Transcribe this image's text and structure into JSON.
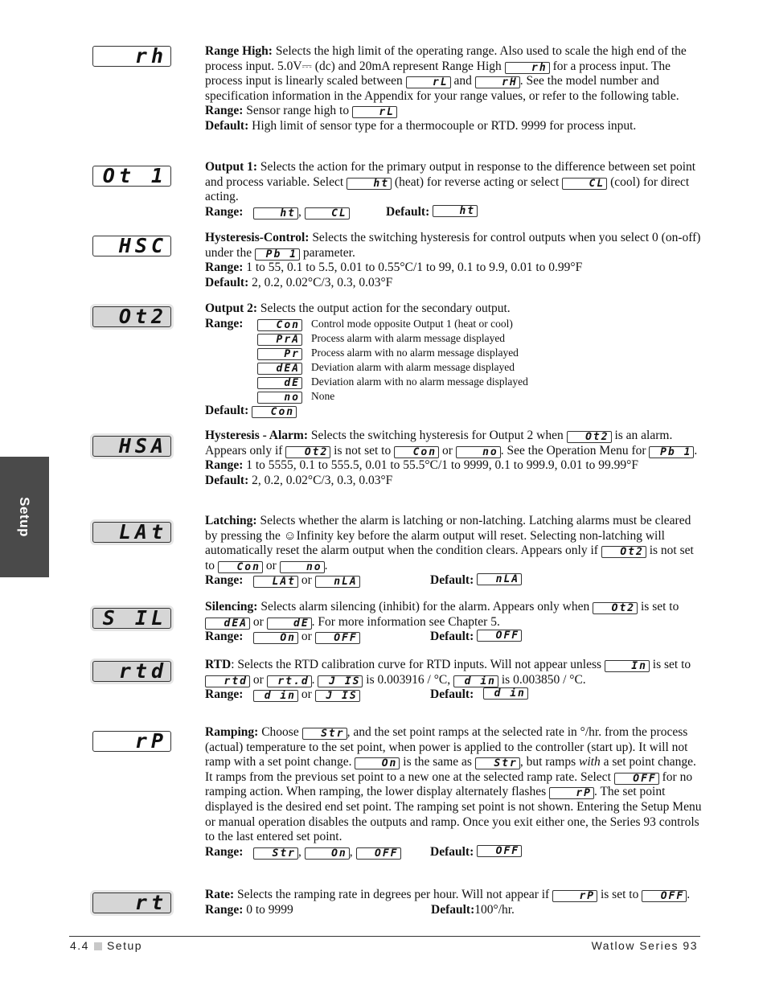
{
  "side_tab": "Setup",
  "footer": {
    "page": "4.4",
    "section": "Setup",
    "product": "Watlow Series 93"
  },
  "entries": {
    "rh": {
      "display": "rh",
      "title": "Range High:",
      "desc1": "Selects the high limit of the operating range. Also used to scale the high end of the process input. 5.0V",
      "dc_symbol": "⎓",
      "desc2": " (dc) and 20mA represent Range High ",
      "d1": "rh",
      "desc3": " for a process input. The process input is linearly scaled between ",
      "d2": "rL",
      "desc4": " and ",
      "d3": "rH",
      "desc5": ". See the model number and specification information in the Appendix for your range values, or refer to the following table.",
      "range_label": "Range:",
      "range_text": "Sensor range high to ",
      "range_d": "rL",
      "default_label": "Default:",
      "default_text": "High limit of sensor type for a thermocouple or RTD. 9999 for process input."
    },
    "ot1": {
      "display": "Ot 1",
      "title": "Output 1:",
      "desc1": "Selects the action for the primary output in response to the difference between set point and process variable. Select ",
      "d1": "ht",
      "desc2": " (heat) for reverse acting or select ",
      "d2": "CL",
      "desc3": " (cool) for direct acting.",
      "range_label": "Range:",
      "range_d1": "ht",
      "range_sep": ",",
      "range_d2": "CL",
      "default_label": "Default:",
      "default_d": "ht"
    },
    "hsc": {
      "display": "HSC",
      "title": "Hysteresis-Control:",
      "desc1": "Selects the switching hysteresis for control outputs when you select 0 (on-off) under the ",
      "d1": "Pb 1",
      "desc2": " parameter.",
      "range_label": "Range:",
      "range_text": "1 to 55, 0.1 to 5.5, 0.01 to 0.55°C/1 to 99, 0.1 to 9.9, 0.01 to 0.99°F",
      "default_label": "Default:",
      "default_text": "2, 0.2, 0.02°C/3, 0.3, 0.03°F"
    },
    "ot2": {
      "display": "Ot2",
      "title": "Output 2:",
      "desc1": "Selects the output action for the secondary output.",
      "range_label": "Range:",
      "options": [
        {
          "code": "Con",
          "text": "Control mode opposite Output 1 (heat or cool)"
        },
        {
          "code": "PrA",
          "text": "Process alarm with alarm message displayed"
        },
        {
          "code": "Pr",
          "text": "Process alarm with no alarm message displayed"
        },
        {
          "code": "dEA",
          "text": "Deviation alarm with alarm message displayed"
        },
        {
          "code": "dE",
          "text": "Deviation alarm with no alarm message displayed"
        },
        {
          "code": "no",
          "text": "None"
        }
      ],
      "default_label": "Default:",
      "default_d": "Con"
    },
    "hsa": {
      "display": "HSA",
      "title": "Hysteresis - Alarm:",
      "desc1": "Selects the switching hysteresis for Output 2 when ",
      "d1": "Ot2",
      "desc2": " is an alarm. Appears only if ",
      "d2": "Ot2",
      "desc3": " is not set to ",
      "d3": "Con",
      "desc4": " or ",
      "d4": "no",
      "desc5": ". See the Operation Menu for ",
      "d5": "Pb 1",
      "desc6": ".",
      "range_label": "Range:",
      "range_text": "1 to 5555, 0.1 to 555.5, 0.01 to 55.5°C/1 to 9999, 0.1 to 999.9, 0.01 to 99.99°F",
      "default_label": "Default:",
      "default_text": "2, 0.2, 0.02°C/3, 0.3, 0.03°F"
    },
    "lat": {
      "display": "LAt",
      "title": "Latching:",
      "desc1": "Selects whether the alarm is latching or non-latching. Latching alarms must be cleared by pressing the ",
      "key_icon": "☺",
      "desc2": "Infinity key before the alarm output will reset. Selecting non-latching will automatically reset the alarm output when the condition clears. Appears only if ",
      "d1": "Ot2",
      "desc3": " is not set to ",
      "d2": "Con",
      "desc4": " or ",
      "d3": "no",
      "desc5": ".",
      "range_label": "Range:",
      "range_d1": "LAt",
      "range_sep": " or ",
      "range_d2": "nLA",
      "default_label": "Default:",
      "default_d": "nLA"
    },
    "sil": {
      "display": "S IL",
      "title": "Silencing:",
      "desc1": "Selects alarm silencing (inhibit) for the alarm. Appears only when ",
      "d1": "Ot2",
      "desc2": " is set to ",
      "d2": "dEA",
      "desc3": " or ",
      "d3": "dE",
      "desc4": ". For more information see Chapter 5.",
      "range_label": "Range:",
      "range_d1": "On",
      "range_sep": " or ",
      "range_d2": "OFF",
      "default_label": "Default:",
      "default_d": "OFF"
    },
    "rtd": {
      "display": "rtd",
      "title": "RTD",
      "desc1": ": Selects the RTD calibration curve for RTD inputs. Will not appear unless ",
      "d1": "In",
      "desc2": " is set to ",
      "d2": "rtd",
      "desc3": " or ",
      "d3": "rt.d",
      "desc4": ". ",
      "d4": "J IS",
      "desc5": " is 0.003916  /  °C, ",
      "d5": "d in",
      "desc6": " is 0.003850  /  °C.",
      "range_label": "Range:",
      "range_d1": "d in",
      "range_sep": " or ",
      "range_d2": "J IS",
      "default_label": "Default:",
      "default_d": "d in"
    },
    "rp": {
      "display": "rP",
      "title": "Ramping:",
      "desc1": " Choose ",
      "d1": "Str",
      "desc2": ", and the set point ramps at the selected rate in °/hr. from the process (actual) temperature to the set point, when power is applied to the controller (start up). It will not ramp with a set point change. ",
      "d2": "On",
      "desc3": " is the same as ",
      "d3": "Str",
      "desc4": ", but ramps ",
      "desc4_italic": "with",
      "desc5": " a set point change. It ramps from the previous set point to a new one at the selected ramp rate. Select ",
      "d4": "OFF",
      "desc6": " for no ramping action. When ramping, the lower display alternately flashes ",
      "d5": "rP",
      "desc7": ". The set point displayed is the desired end set point. The ramping set point is not shown. Entering the Setup Menu or manual operation disables the outputs and ramp. Once you exit either one, the Series 93 controls to the last entered set point.",
      "range_label": "Range:",
      "range_d1": "Str",
      "range_d2": "On",
      "range_d3": "OFF",
      "range_sep": ",",
      "default_label": "Default:",
      "default_d": "OFF"
    },
    "rt": {
      "display": "rt",
      "title": "Rate:",
      "desc1": " Selects the ramping rate in degrees per hour. Will not appear if ",
      "d1": "rP",
      "desc2": " is set to ",
      "d2": "OFF",
      "desc3": ".",
      "range_label": "Range:",
      "range_text": " 0 to 9999",
      "default_label": "Default:",
      "default_text": " 100°/hr."
    }
  }
}
